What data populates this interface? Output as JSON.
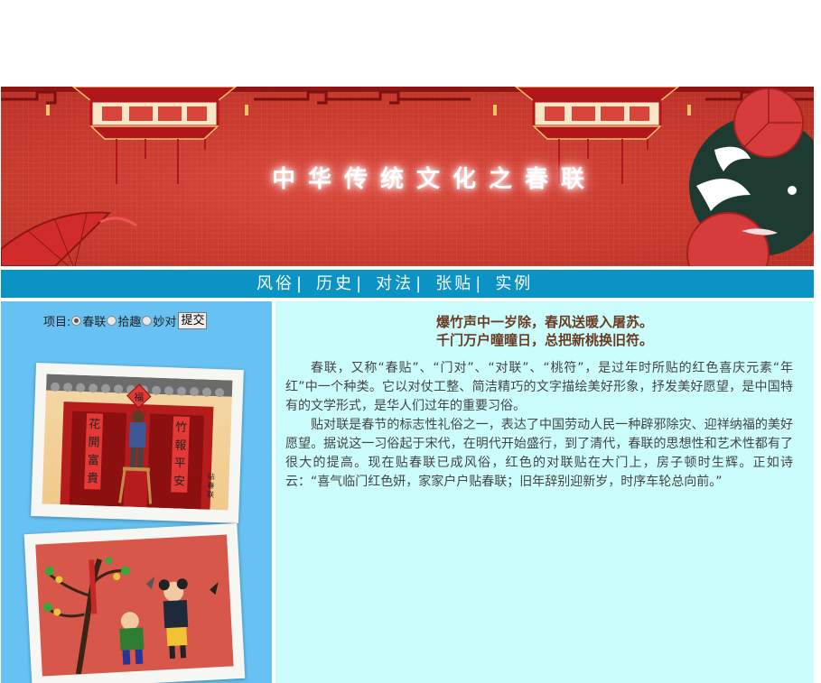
{
  "banner": {
    "title": "中华传统文化之春联"
  },
  "nav": {
    "items": [
      {
        "label": "风俗",
        "sep": "|"
      },
      {
        "label": "历史",
        "sep": "|"
      },
      {
        "label": "对法",
        "sep": "|"
      },
      {
        "label": "张贴",
        "sep": "|"
      },
      {
        "label": "实例",
        "sep": ""
      }
    ]
  },
  "form": {
    "label": "项目:",
    "options": [
      "春联",
      "拾趣",
      "妙对"
    ],
    "selected": "春联",
    "submit": "提交"
  },
  "photos": {
    "photo1": {
      "chars": {
        "top": "福",
        "left": "花开富贵",
        "right": "竹报平安",
        "sign": "贴春联"
      }
    }
  },
  "content": {
    "poem_line1": "爆竹声中一岁除，春风送暖入屠苏。",
    "poem_line2": "千门万户曈曈日，总把新桃换旧符。",
    "paragraph1": "春联，又称“春贴”、“门对”、“对联”、“桃符”，是过年时所贴的红色喜庆元素“年红”中一个种类。它以对仗工整、简洁精巧的文字描绘美好形象，抒发美好愿望，是中国特有的文学形式，是华人们过年的重要习俗。",
    "paragraph2": "贴对联是春节的标志性礼俗之一，表达了中国劳动人民一种辟邪除灾、迎祥纳福的美好愿望。据说这一习俗起于宋代，在明代开始盛行，到了清代，春联的思想性和艺术性都有了很大的提高。现在贴春联已成风俗，红色的对联贴在大门上，房子顿时生辉。正如诗云：“喜气临门红色妍，家家户户贴春联；旧年辞别迎新岁，时序车轮总向前。”"
  },
  "colors": {
    "nav_bg": "#0b93c6",
    "left_bg": "#67c2f3",
    "right_bg": "#ccfdfd",
    "banner_red": "#c93a2e"
  }
}
